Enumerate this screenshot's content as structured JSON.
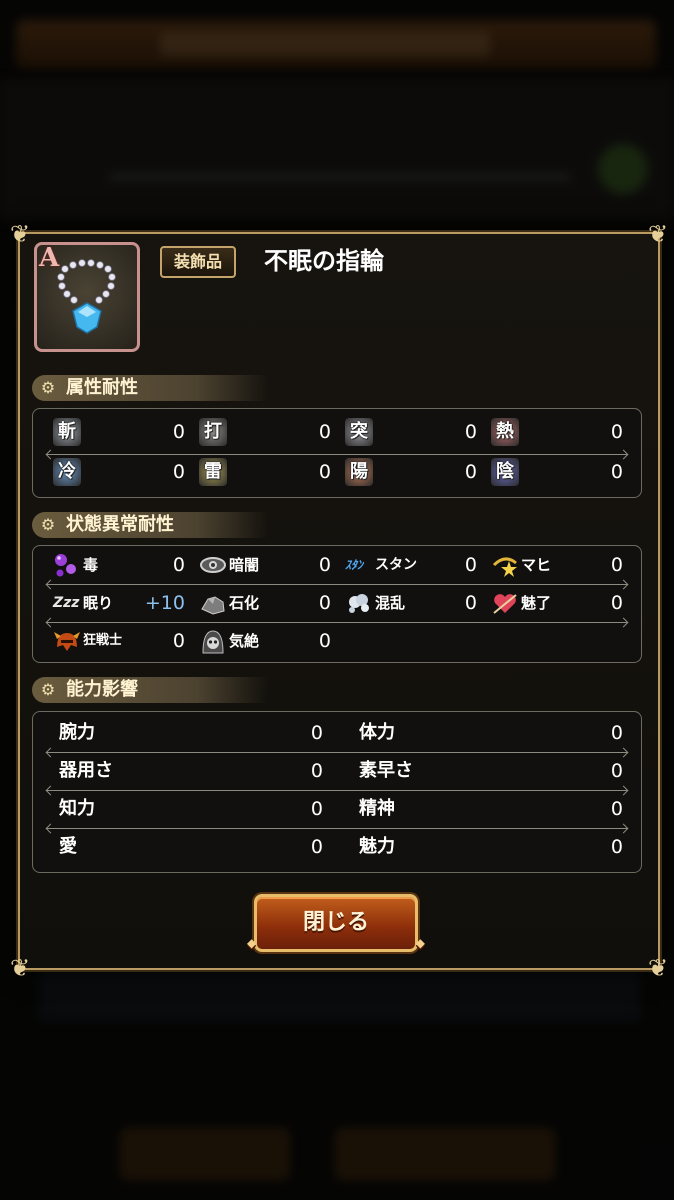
{
  "item": {
    "rank": "A",
    "category": "装飾品",
    "name": "不眠の指輪",
    "icon": "blue-gem-necklace-icon"
  },
  "sections": {
    "elemental": {
      "title": "属性耐性",
      "rows": [
        [
          {
            "glyph": "斬",
            "value": "0"
          },
          {
            "glyph": "打",
            "value": "0"
          },
          {
            "glyph": "突",
            "value": "0"
          },
          {
            "glyph": "熱",
            "value": "0"
          }
        ],
        [
          {
            "glyph": "冷",
            "value": "0"
          },
          {
            "glyph": "雷",
            "value": "0"
          },
          {
            "glyph": "陽",
            "value": "0"
          },
          {
            "glyph": "陰",
            "value": "0"
          }
        ]
      ]
    },
    "status": {
      "title": "状態異常耐性",
      "rows": [
        [
          {
            "icon": "poison-bubbles-icon",
            "label": "毒",
            "value": "0"
          },
          {
            "icon": "eye-icon",
            "label": "暗闇",
            "value": "0"
          },
          {
            "icon": "stun-text-icon",
            "icon_text": "ｽﾀﾝ",
            "label": "スタン",
            "value": "0"
          },
          {
            "icon": "paralysis-star-icon",
            "label": "マヒ",
            "value": "0"
          }
        ],
        [
          {
            "icon": "sleep-zzz-icon",
            "icon_text": "Zzz",
            "label": "眠り",
            "value": "+10"
          },
          {
            "icon": "stone-icon",
            "label": "石化",
            "value": "0"
          },
          {
            "icon": "confusion-cloud-icon",
            "label": "混乱",
            "value": "0"
          },
          {
            "icon": "charm-heart-icon",
            "label": "魅了",
            "value": "0"
          }
        ],
        [
          {
            "icon": "berserk-helmet-icon",
            "label": "狂戦士",
            "value": "0"
          },
          {
            "icon": "faint-skull-icon",
            "label": "気絶",
            "value": "0"
          }
        ]
      ]
    },
    "ability": {
      "title": "能力影響",
      "rows": [
        [
          {
            "label": "腕力",
            "value": "0"
          },
          {
            "label": "体力",
            "value": "0"
          }
        ],
        [
          {
            "label": "器用さ",
            "value": "0"
          },
          {
            "label": "素早さ",
            "value": "0"
          }
        ],
        [
          {
            "label": "知力",
            "value": "0"
          },
          {
            "label": "精神",
            "value": "0"
          }
        ],
        [
          {
            "label": "愛",
            "value": "0"
          },
          {
            "label": "魅力",
            "value": "0"
          }
        ]
      ]
    }
  },
  "close_label": "閉じる",
  "colors": {
    "frame_gold": "#b99a62",
    "plus_value": "#8cc0ef",
    "button_orange": "#c25f1c"
  }
}
